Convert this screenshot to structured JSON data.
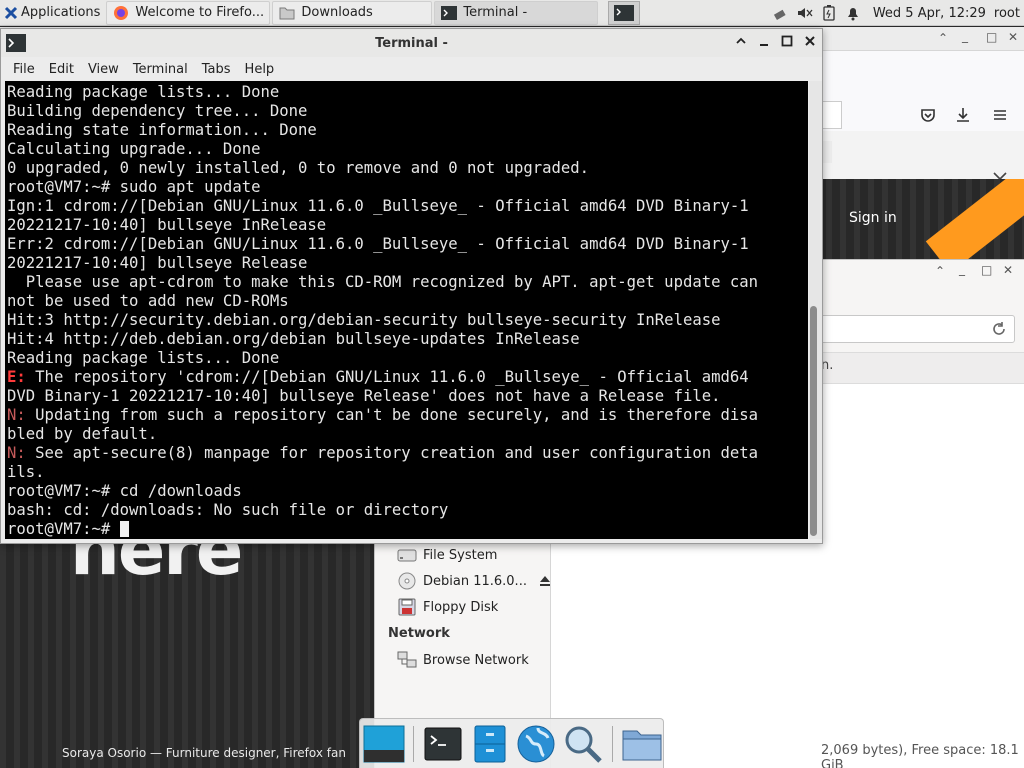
{
  "panel": {
    "apps_label": "Applications",
    "tasks": [
      {
        "label": "Welcome to Firefo...",
        "icon": "firefox-icon"
      },
      {
        "label": "Downloads",
        "icon": "folder-icon"
      },
      {
        "label": "Terminal -",
        "icon": "terminal-icon"
      }
    ],
    "clock": "Wed  5 Apr, 12:29",
    "user": "root"
  },
  "firefox": {
    "sign_in": "Sign in",
    "hero_text": "here",
    "caption": "Soraya Osorio — Furniture designer, Firefox fan"
  },
  "file_manager": {
    "infobar_text": "n.",
    "devices": [
      {
        "label": "File System",
        "icon": "drive-icon"
      },
      {
        "label": "Debian 11.6.0...",
        "icon": "disc-icon"
      },
      {
        "label": "Floppy Disk",
        "icon": "floppy-icon"
      }
    ],
    "network_heading": "Network",
    "network_items": [
      {
        "label": "Browse Network",
        "icon": "network-icon"
      }
    ],
    "status": "2,069 bytes), Free space: 18.1 GiB"
  },
  "terminal": {
    "title": "Terminal -",
    "menu": [
      "File",
      "Edit",
      "View",
      "Terminal",
      "Tabs",
      "Help"
    ],
    "lines": [
      {
        "text": "Reading package lists... Done"
      },
      {
        "text": "Building dependency tree... Done"
      },
      {
        "text": "Reading state information... Done"
      },
      {
        "text": "Calculating upgrade... Done"
      },
      {
        "text": "0 upgraded, 0 newly installed, 0 to remove and 0 not upgraded."
      },
      {
        "text": "root@VM7:~# sudo apt update"
      },
      {
        "text": "Ign:1 cdrom://[Debian GNU/Linux 11.6.0 _Bullseye_ - Official amd64 DVD Binary-1"
      },
      {
        "text": "20221217-10:40] bullseye InRelease"
      },
      {
        "text": "Err:2 cdrom://[Debian GNU/Linux 11.6.0 _Bullseye_ - Official amd64 DVD Binary-1"
      },
      {
        "text": "20221217-10:40] bullseye Release"
      },
      {
        "text": "  Please use apt-cdrom to make this CD-ROM recognized by APT. apt-get update can"
      },
      {
        "text": "not be used to add new CD-ROMs"
      },
      {
        "text": "Hit:3 http://security.debian.org/debian-security bullseye-security InRelease"
      },
      {
        "text": "Hit:4 http://deb.debian.org/debian bullseye-updates InRelease"
      },
      {
        "text": "Reading package lists... Done"
      },
      {
        "prefix": "E:",
        "prefix_type": "err",
        "text": " The repository 'cdrom://[Debian GNU/Linux 11.6.0 _Bullseye_ - Official amd64"
      },
      {
        "text": "DVD Binary-1 20221217-10:40] bullseye Release' does not have a Release file."
      },
      {
        "prefix": "N:",
        "prefix_type": "note",
        "text": " Updating from such a repository can't be done securely, and is therefore disa"
      },
      {
        "text": "bled by default."
      },
      {
        "prefix": "N:",
        "prefix_type": "note",
        "text": " See apt-secure(8) manpage for repository creation and user configuration deta"
      },
      {
        "text": "ils."
      },
      {
        "text": "root@VM7:~# cd /downloads"
      },
      {
        "text": "bash: cd: /downloads: No such file or directory"
      },
      {
        "text": "root@VM7:~# ",
        "cursor": true
      }
    ]
  },
  "dock": {
    "items": [
      {
        "name": "show-desktop-icon"
      },
      {
        "name": "terminal-icon"
      },
      {
        "name": "file-manager-icon"
      },
      {
        "name": "web-browser-icon"
      },
      {
        "name": "app-finder-icon"
      },
      {
        "name": "home-folder-icon"
      }
    ]
  }
}
